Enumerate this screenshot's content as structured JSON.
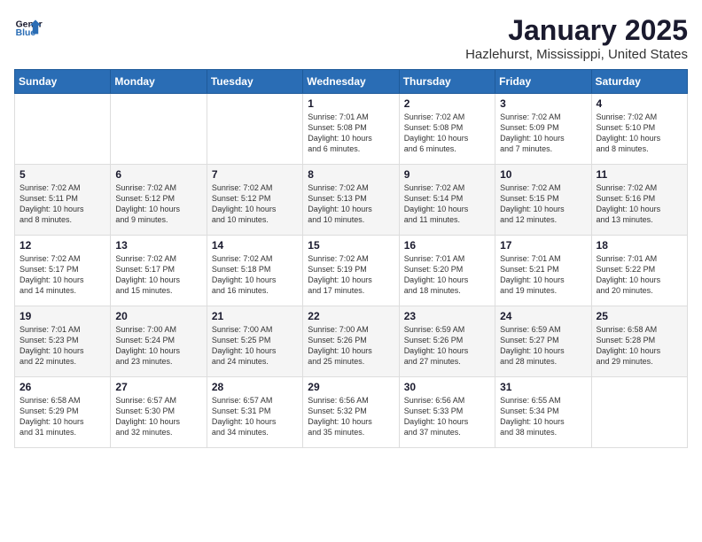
{
  "logo": {
    "line1": "General",
    "line2": "Blue"
  },
  "title": "January 2025",
  "subtitle": "Hazlehurst, Mississippi, United States",
  "days_of_week": [
    "Sunday",
    "Monday",
    "Tuesday",
    "Wednesday",
    "Thursday",
    "Friday",
    "Saturday"
  ],
  "weeks": [
    [
      {
        "num": "",
        "info": ""
      },
      {
        "num": "",
        "info": ""
      },
      {
        "num": "",
        "info": ""
      },
      {
        "num": "1",
        "info": "Sunrise: 7:01 AM\nSunset: 5:08 PM\nDaylight: 10 hours\nand 6 minutes."
      },
      {
        "num": "2",
        "info": "Sunrise: 7:02 AM\nSunset: 5:08 PM\nDaylight: 10 hours\nand 6 minutes."
      },
      {
        "num": "3",
        "info": "Sunrise: 7:02 AM\nSunset: 5:09 PM\nDaylight: 10 hours\nand 7 minutes."
      },
      {
        "num": "4",
        "info": "Sunrise: 7:02 AM\nSunset: 5:10 PM\nDaylight: 10 hours\nand 8 minutes."
      }
    ],
    [
      {
        "num": "5",
        "info": "Sunrise: 7:02 AM\nSunset: 5:11 PM\nDaylight: 10 hours\nand 8 minutes."
      },
      {
        "num": "6",
        "info": "Sunrise: 7:02 AM\nSunset: 5:12 PM\nDaylight: 10 hours\nand 9 minutes."
      },
      {
        "num": "7",
        "info": "Sunrise: 7:02 AM\nSunset: 5:12 PM\nDaylight: 10 hours\nand 10 minutes."
      },
      {
        "num": "8",
        "info": "Sunrise: 7:02 AM\nSunset: 5:13 PM\nDaylight: 10 hours\nand 10 minutes."
      },
      {
        "num": "9",
        "info": "Sunrise: 7:02 AM\nSunset: 5:14 PM\nDaylight: 10 hours\nand 11 minutes."
      },
      {
        "num": "10",
        "info": "Sunrise: 7:02 AM\nSunset: 5:15 PM\nDaylight: 10 hours\nand 12 minutes."
      },
      {
        "num": "11",
        "info": "Sunrise: 7:02 AM\nSunset: 5:16 PM\nDaylight: 10 hours\nand 13 minutes."
      }
    ],
    [
      {
        "num": "12",
        "info": "Sunrise: 7:02 AM\nSunset: 5:17 PM\nDaylight: 10 hours\nand 14 minutes."
      },
      {
        "num": "13",
        "info": "Sunrise: 7:02 AM\nSunset: 5:17 PM\nDaylight: 10 hours\nand 15 minutes."
      },
      {
        "num": "14",
        "info": "Sunrise: 7:02 AM\nSunset: 5:18 PM\nDaylight: 10 hours\nand 16 minutes."
      },
      {
        "num": "15",
        "info": "Sunrise: 7:02 AM\nSunset: 5:19 PM\nDaylight: 10 hours\nand 17 minutes."
      },
      {
        "num": "16",
        "info": "Sunrise: 7:01 AM\nSunset: 5:20 PM\nDaylight: 10 hours\nand 18 minutes."
      },
      {
        "num": "17",
        "info": "Sunrise: 7:01 AM\nSunset: 5:21 PM\nDaylight: 10 hours\nand 19 minutes."
      },
      {
        "num": "18",
        "info": "Sunrise: 7:01 AM\nSunset: 5:22 PM\nDaylight: 10 hours\nand 20 minutes."
      }
    ],
    [
      {
        "num": "19",
        "info": "Sunrise: 7:01 AM\nSunset: 5:23 PM\nDaylight: 10 hours\nand 22 minutes."
      },
      {
        "num": "20",
        "info": "Sunrise: 7:00 AM\nSunset: 5:24 PM\nDaylight: 10 hours\nand 23 minutes."
      },
      {
        "num": "21",
        "info": "Sunrise: 7:00 AM\nSunset: 5:25 PM\nDaylight: 10 hours\nand 24 minutes."
      },
      {
        "num": "22",
        "info": "Sunrise: 7:00 AM\nSunset: 5:26 PM\nDaylight: 10 hours\nand 25 minutes."
      },
      {
        "num": "23",
        "info": "Sunrise: 6:59 AM\nSunset: 5:26 PM\nDaylight: 10 hours\nand 27 minutes."
      },
      {
        "num": "24",
        "info": "Sunrise: 6:59 AM\nSunset: 5:27 PM\nDaylight: 10 hours\nand 28 minutes."
      },
      {
        "num": "25",
        "info": "Sunrise: 6:58 AM\nSunset: 5:28 PM\nDaylight: 10 hours\nand 29 minutes."
      }
    ],
    [
      {
        "num": "26",
        "info": "Sunrise: 6:58 AM\nSunset: 5:29 PM\nDaylight: 10 hours\nand 31 minutes."
      },
      {
        "num": "27",
        "info": "Sunrise: 6:57 AM\nSunset: 5:30 PM\nDaylight: 10 hours\nand 32 minutes."
      },
      {
        "num": "28",
        "info": "Sunrise: 6:57 AM\nSunset: 5:31 PM\nDaylight: 10 hours\nand 34 minutes."
      },
      {
        "num": "29",
        "info": "Sunrise: 6:56 AM\nSunset: 5:32 PM\nDaylight: 10 hours\nand 35 minutes."
      },
      {
        "num": "30",
        "info": "Sunrise: 6:56 AM\nSunset: 5:33 PM\nDaylight: 10 hours\nand 37 minutes."
      },
      {
        "num": "31",
        "info": "Sunrise: 6:55 AM\nSunset: 5:34 PM\nDaylight: 10 hours\nand 38 minutes."
      },
      {
        "num": "",
        "info": ""
      }
    ]
  ]
}
